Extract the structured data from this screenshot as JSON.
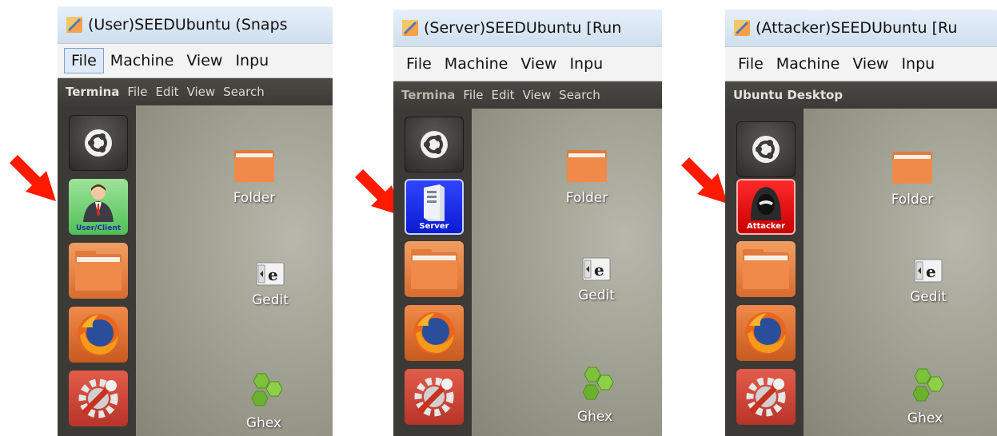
{
  "menu": [
    "File",
    "Machine",
    "View",
    "Inpu"
  ],
  "terminal_menu": [
    "File",
    "Edit",
    "View",
    "Search"
  ],
  "desktop_icons": {
    "folder": "Folder",
    "gedit": "Gedit",
    "ghex": "Ghex"
  },
  "panels": [
    {
      "title": "(User)SEEDUbuntu (Snaps",
      "top_bar_app": "Termina",
      "role_label": "User/Client"
    },
    {
      "title": "(Server)SEEDUbuntu [Run",
      "top_bar_app": "Termina",
      "role_label": "Server"
    },
    {
      "title": "(Attacker)SEEDUbuntu [Ru",
      "top_bar_app": "Ubuntu Desktop",
      "role_label": "Attacker"
    }
  ],
  "colors": {
    "arrow": "#ff1a00",
    "user_tile": "#57c35c",
    "server_tile": "#1020e0",
    "attacker_tile": "#e00000"
  }
}
